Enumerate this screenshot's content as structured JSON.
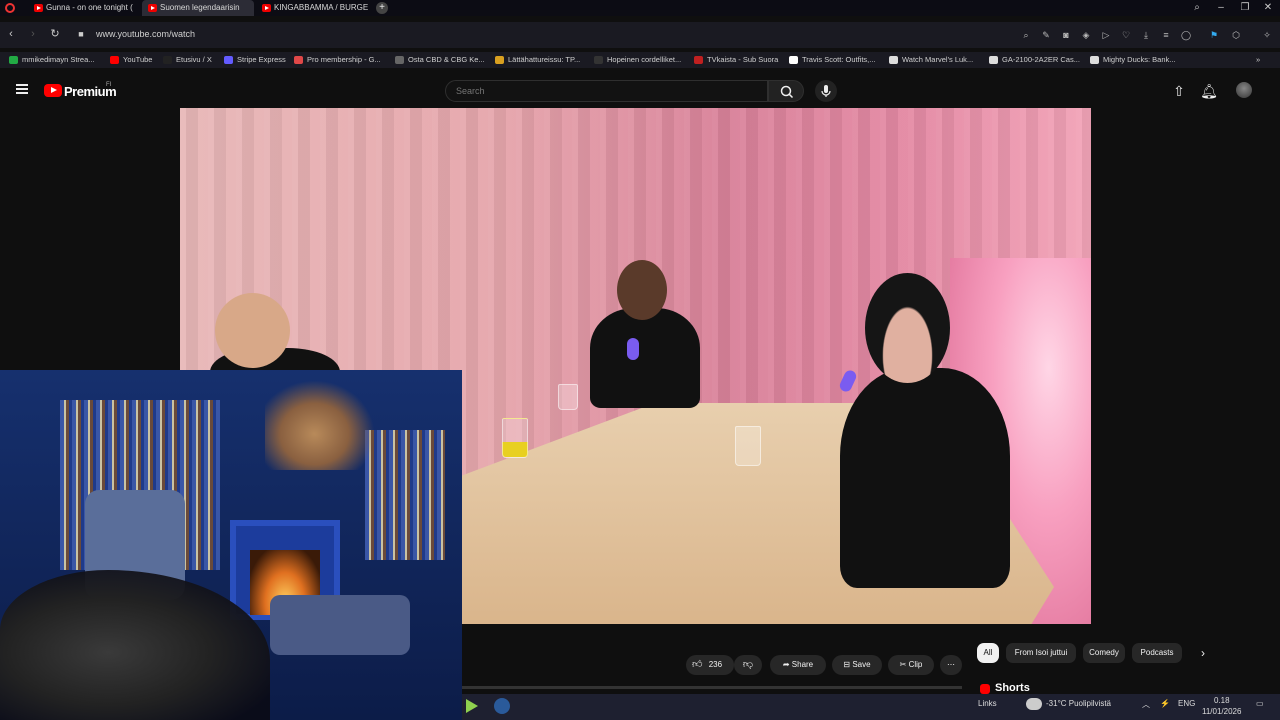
{
  "browser": {
    "tabs": [
      {
        "label": "Gunna - on one tonight (",
        "active": false
      },
      {
        "label": "Suomen legendaarisin",
        "active": true
      },
      {
        "label": "KINGABBAMMA / BURGE",
        "active": false
      }
    ],
    "new_tab_glyph": "+",
    "url": "www.youtube.com/watch",
    "bookmarks": [
      {
        "label": "mmikedimayn Strea...",
        "color": "#22aa44"
      },
      {
        "label": "YouTube",
        "color": "#ff0000"
      },
      {
        "label": "Etusivu / X",
        "color": "#222222"
      },
      {
        "label": "Stripe Express",
        "color": "#635bff"
      },
      {
        "label": "Pro membership - G...",
        "color": "#e04848"
      },
      {
        "label": "Osta CBD & CBG Ke...",
        "color": "#666666"
      },
      {
        "label": "Lättähattureissu: TP...",
        "color": "#d9a020"
      },
      {
        "label": "Hopeinen cordelliket...",
        "color": "#333333"
      },
      {
        "label": "TVkaista - Sub Suora",
        "color": "#c02020"
      },
      {
        "label": "Travis Scott: Outfits,...",
        "color": "#ffffff"
      },
      {
        "label": "Watch Marvel's Luk...",
        "color": "#dddddd"
      },
      {
        "label": "GA-2100-2A2ER Cas...",
        "color": "#dddddd"
      },
      {
        "label": "Mighty Ducks: Bank...",
        "color": "#dddddd"
      }
    ]
  },
  "youtube": {
    "logo_text": "Premium",
    "region": "FI",
    "search_placeholder": "Search",
    "actions": {
      "like_count": "236",
      "share_label": "Share",
      "save_label": "Save",
      "clip_label": "Clip",
      "more_glyph": "⋯"
    },
    "chips": [
      {
        "label": "All",
        "selected": true
      },
      {
        "label": "From Isoi juttui",
        "selected": false
      },
      {
        "label": "Comedy",
        "selected": false
      },
      {
        "label": "Podcasts",
        "selected": false
      }
    ],
    "shorts_title": "Shorts"
  },
  "taskbar": {
    "links_label": "Links",
    "weather": "-31°C  Puolipilvistä",
    "language": "ENG",
    "time": "0.18",
    "date": "11/01/2026"
  },
  "colors": {
    "accent": "#ff0000",
    "background": "#0f0f0f"
  }
}
